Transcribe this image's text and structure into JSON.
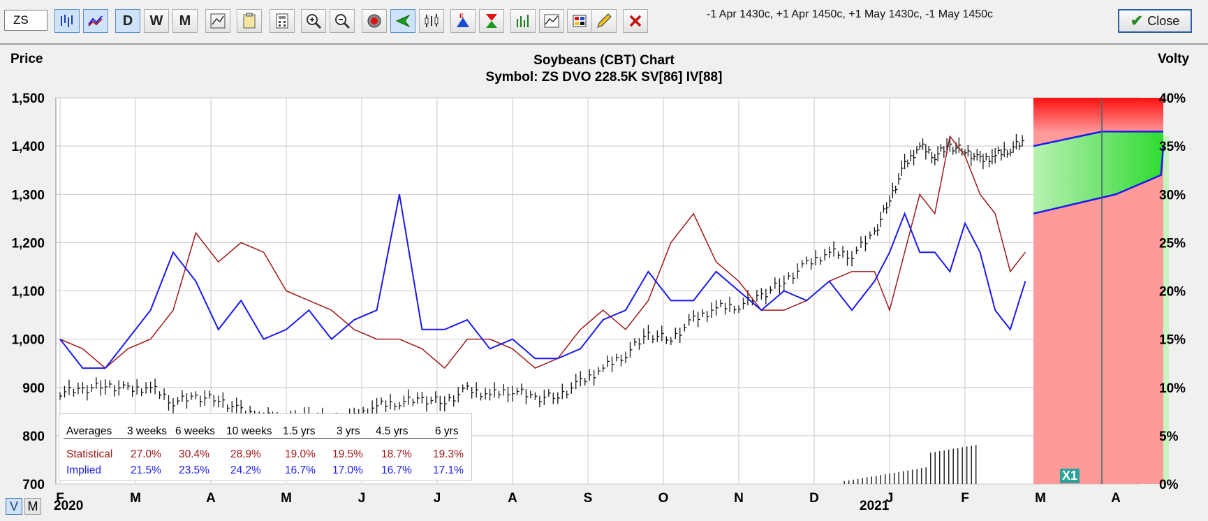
{
  "toolbar": {
    "symbol": "ZS",
    "strategy": "-1 Apr 1430c, +1 Apr 1450c, +1 May 1430c, -1 May 1450c",
    "period_buttons": [
      "D",
      "W",
      "M"
    ],
    "close_label": "Close"
  },
  "chart": {
    "title": "Soybeans (CBT) Chart",
    "subtitle": "Symbol: ZS  DVO 228.5K  SV[86]  IV[88]",
    "left_axis_title": "Price",
    "right_axis_title": "Volty",
    "price_ticks": [
      "1,500",
      "1,400",
      "1,300",
      "1,200",
      "1,100",
      "1,000",
      "900",
      "800",
      "700"
    ],
    "vol_ticks": [
      "40%",
      "35%",
      "30%",
      "25%",
      "20%",
      "15%",
      "10%",
      "5%",
      "0%"
    ],
    "month_labels": [
      "F",
      "M",
      "A",
      "M",
      "J",
      "J",
      "A",
      "S",
      "O",
      "N",
      "D",
      "J",
      "F",
      "M",
      "A"
    ],
    "year_labels": [
      "2020",
      "2021"
    ],
    "marker_label": "X1",
    "view_buttons": [
      "V",
      "M"
    ]
  },
  "averages": {
    "header": [
      "Averages",
      "3 weeks",
      "6 weeks",
      "10 weeks",
      "1.5 yrs",
      "3 yrs",
      "4.5 yrs",
      "6 yrs"
    ],
    "statistical_label": "Statistical",
    "statistical": [
      "27.0%",
      "30.4%",
      "28.9%",
      "19.0%",
      "19.5%",
      "18.7%",
      "19.3%"
    ],
    "implied_label": "Implied",
    "implied": [
      "21.5%",
      "23.5%",
      "24.2%",
      "16.7%",
      "17.0%",
      "16.7%",
      "17.1%"
    ]
  },
  "colors": {
    "price": "#111111",
    "statistical_vol": "#a01818",
    "implied_vol": "#1a1af0",
    "profit_zone": "#6fe46f",
    "loss_zone": "#ff9a9a"
  },
  "chart_data": {
    "type": "line",
    "title": "Soybeans (CBT) Chart",
    "x_unit": "month",
    "x_categories": [
      "Feb 2020",
      "Mar",
      "Apr",
      "May",
      "Jun",
      "Jul",
      "Aug",
      "Sep",
      "Oct",
      "Nov",
      "Dec",
      "Jan 2021",
      "Feb",
      "Mar",
      "Apr"
    ],
    "ylabel": "Price",
    "ylim": [
      700,
      1500
    ],
    "y2label": "Volty",
    "y2lim": [
      0,
      40
    ],
    "series": [
      {
        "axis": "left",
        "kind": "ohlc",
        "x": [
          0,
          0.3,
          0.6,
          0.9,
          1.2,
          1.5,
          1.8,
          2.1,
          2.4,
          2.7,
          3.0,
          3.3,
          3.6,
          3.9,
          4.2,
          4.5,
          4.8,
          5.1,
          5.4,
          5.7,
          6.0,
          6.3,
          6.6,
          6.9,
          7.2,
          7.5,
          7.8,
          8.1,
          8.4,
          8.7,
          9.0,
          9.3,
          9.6,
          9.9,
          10.2,
          10.5,
          10.8,
          11.0,
          11.2,
          11.4,
          11.6,
          11.8,
          12.0,
          12.2,
          12.4,
          12.6,
          12.8
        ],
        "values": [
          890,
          895,
          905,
          895,
          900,
          870,
          880,
          875,
          850,
          840,
          835,
          840,
          830,
          838,
          862,
          870,
          875,
          870,
          895,
          885,
          895,
          878,
          882,
          910,
          940,
          970,
          1010,
          1000,
          1040,
          1065,
          1070,
          1090,
          1120,
          1155,
          1180,
          1175,
          1220,
          1290,
          1360,
          1400,
          1380,
          1400,
          1390,
          1370,
          1380,
          1395,
          1410
        ]
      },
      {
        "axis": "right",
        "name": "Statistical",
        "kind": "line",
        "x": [
          0,
          0.3,
          0.6,
          0.9,
          1.2,
          1.5,
          1.8,
          2.1,
          2.4,
          2.7,
          3.0,
          3.3,
          3.6,
          3.9,
          4.2,
          4.5,
          4.8,
          5.1,
          5.4,
          5.7,
          6.0,
          6.3,
          6.6,
          6.9,
          7.2,
          7.5,
          7.8,
          8.1,
          8.4,
          8.7,
          9.0,
          9.3,
          9.6,
          9.9,
          10.2,
          10.5,
          10.8,
          11.0,
          11.2,
          11.4,
          11.6,
          11.8,
          12.0,
          12.2,
          12.4,
          12.6,
          12.8
        ],
        "values": [
          15,
          14,
          12,
          14,
          15,
          18,
          26,
          23,
          25,
          24,
          20,
          19,
          18,
          16,
          15,
          15,
          14,
          12,
          15,
          15,
          14,
          12,
          13,
          16,
          18,
          16,
          19,
          25,
          28,
          23,
          21,
          18,
          18,
          19,
          21,
          22,
          22,
          18,
          24,
          30,
          28,
          36,
          34,
          30,
          28,
          22,
          24
        ]
      },
      {
        "axis": "right",
        "name": "Implied",
        "kind": "line",
        "x": [
          0,
          0.3,
          0.6,
          0.9,
          1.2,
          1.5,
          1.8,
          2.1,
          2.4,
          2.7,
          3.0,
          3.3,
          3.6,
          3.9,
          4.2,
          4.5,
          4.8,
          5.1,
          5.4,
          5.7,
          6.0,
          6.3,
          6.6,
          6.9,
          7.2,
          7.5,
          7.8,
          8.1,
          8.4,
          8.7,
          9.0,
          9.3,
          9.6,
          9.9,
          10.2,
          10.5,
          10.8,
          11.0,
          11.2,
          11.4,
          11.6,
          11.8,
          12.0,
          12.2,
          12.4,
          12.6,
          12.8
        ],
        "values": [
          15,
          12,
          12,
          15,
          18,
          24,
          21,
          16,
          19,
          15,
          16,
          18,
          15,
          17,
          18,
          30,
          16,
          16,
          17,
          14,
          15,
          13,
          13,
          14,
          17,
          18,
          22,
          19,
          19,
          22,
          20,
          18,
          20,
          19,
          21,
          18,
          21,
          24,
          28,
          24,
          24,
          22,
          27,
          24,
          18,
          16,
          21
        ]
      }
    ],
    "legend": "table-bottom-left"
  }
}
